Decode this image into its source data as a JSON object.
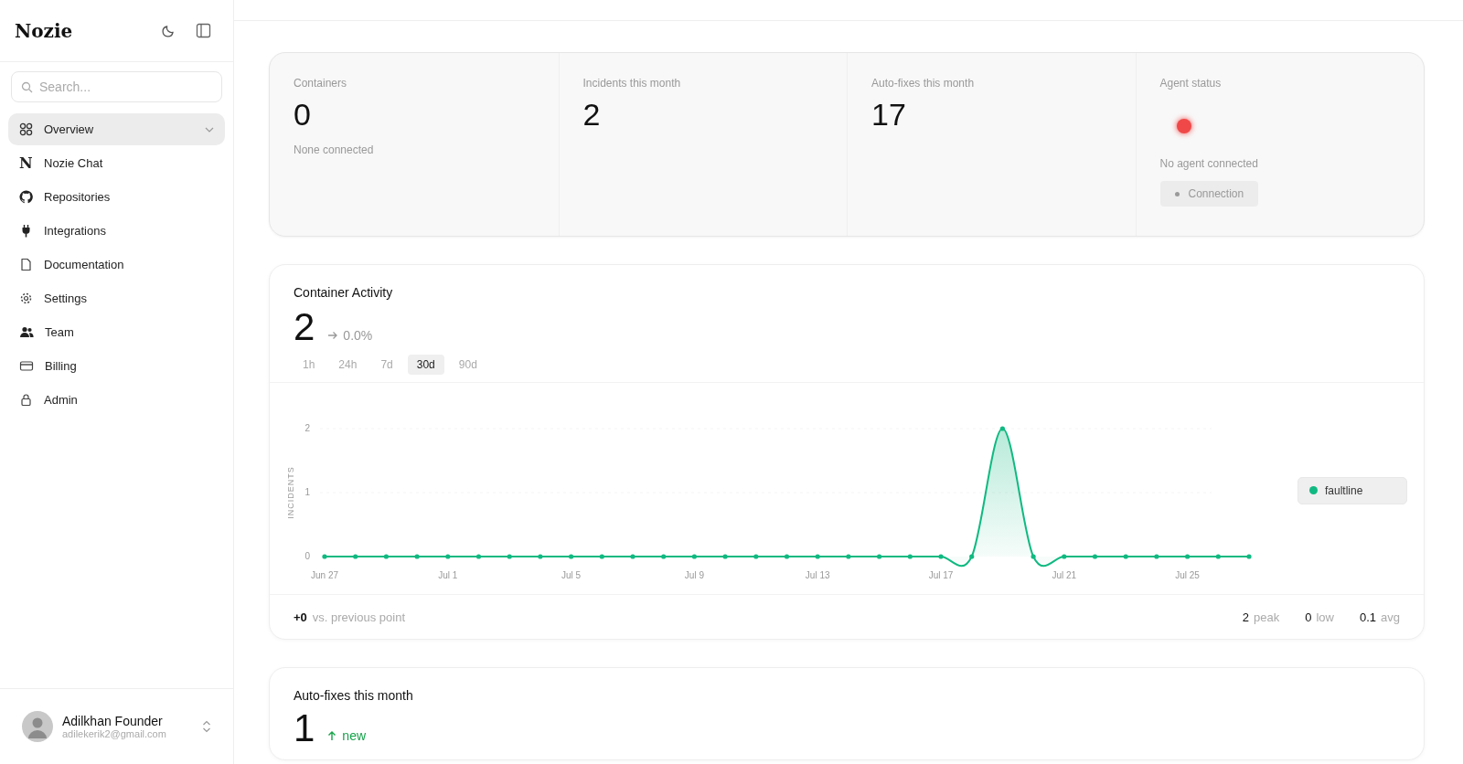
{
  "sidebar": {
    "brand": "Nozie",
    "search": {
      "placeholder": "Search..."
    },
    "items": [
      {
        "label": "Overview",
        "kind": "grid",
        "selected": true,
        "expandable": true
      },
      {
        "label": "Nozie Chat",
        "kind": "letter",
        "glyph": "N",
        "selected": false,
        "expandable": false
      },
      {
        "label": "Repositories",
        "kind": "github",
        "selected": false,
        "expandable": false
      },
      {
        "label": "Integrations",
        "kind": "plug",
        "selected": false,
        "expandable": false
      },
      {
        "label": "Documentation",
        "kind": "file",
        "selected": false,
        "expandable": false
      },
      {
        "label": "Settings",
        "kind": "gear",
        "selected": false,
        "expandable": false
      },
      {
        "label": "Team",
        "kind": "users",
        "selected": false,
        "expandable": false
      },
      {
        "label": "Billing",
        "kind": "card",
        "selected": false,
        "expandable": false
      },
      {
        "label": "Admin",
        "kind": "lock",
        "selected": false,
        "expandable": false
      }
    ],
    "user": {
      "name": "Adilkhan Founder",
      "email": "adilekerik2@gmail.com"
    }
  },
  "stats": [
    {
      "kind": "number",
      "label": "Containers",
      "value": "0",
      "note": "None connected"
    },
    {
      "kind": "number",
      "label": "Incidents this month",
      "value": "2"
    },
    {
      "kind": "number",
      "label": "Auto-fixes this month",
      "value": "17"
    },
    {
      "kind": "status",
      "label": "Agent status",
      "color": "#f04848",
      "note": "No agent connected",
      "button": {
        "label": "Connection",
        "disabled": true
      }
    }
  ],
  "activity": {
    "title": "Container Activity",
    "value": "2",
    "change": "0.0%",
    "ranges": [
      {
        "label": "1h",
        "selected": false
      },
      {
        "label": "24h",
        "selected": false
      },
      {
        "label": "7d",
        "selected": false
      },
      {
        "label": "30d",
        "selected": true
      },
      {
        "label": "90d",
        "selected": false
      }
    ],
    "chart_data": {
      "type": "area",
      "ylabel": "INCIDENTS",
      "categories": [
        "Jun 27",
        null,
        null,
        null,
        "Jul 1",
        null,
        null,
        null,
        "Jul 5",
        null,
        null,
        null,
        "Jul 9",
        null,
        null,
        null,
        "Jul 13",
        null,
        null,
        null,
        "Jul 17",
        null,
        null,
        null,
        "Jul 21",
        null,
        null,
        null,
        "Jul 25",
        null,
        null
      ],
      "series": [
        {
          "name": "faultline",
          "color": "#10b981",
          "values": [
            0,
            0,
            0,
            0,
            0,
            0,
            0,
            0,
            0,
            0,
            0,
            0,
            0,
            0,
            0,
            0,
            0,
            0,
            0,
            0,
            0,
            0,
            2,
            0,
            0,
            0,
            0,
            0,
            0,
            0,
            0
          ]
        }
      ],
      "ylim": [
        0,
        2
      ],
      "yticks": [
        0,
        1,
        2
      ]
    },
    "footer": {
      "delta": "+0",
      "delta_label": "vs. previous point",
      "stats": [
        {
          "value": "2",
          "label": "peak"
        },
        {
          "value": "0",
          "label": "low"
        },
        {
          "value": "0.1",
          "label": "avg"
        }
      ]
    }
  },
  "autofixes": {
    "title": "Auto-fixes this month",
    "value": "1",
    "change": "new"
  }
}
